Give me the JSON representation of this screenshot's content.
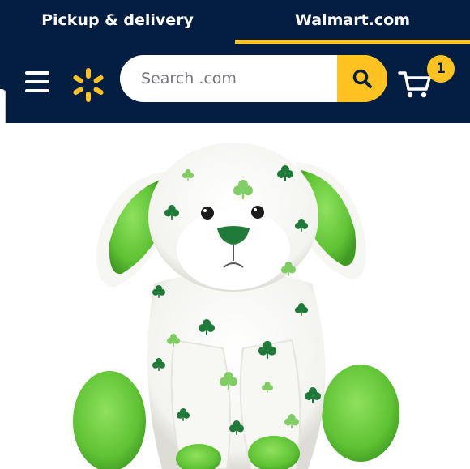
{
  "header": {
    "tabs": [
      {
        "label": "Pickup & delivery",
        "active": false
      },
      {
        "label": "Walmart.com",
        "active": true
      }
    ],
    "search": {
      "placeholder": "Search .com",
      "value": ""
    },
    "cart": {
      "count": "1"
    }
  },
  "colors": {
    "header_background": "#041e42",
    "accent_yellow": "#ffc220",
    "plush_green": "#63c43c",
    "clover_dark_green": "#1f7a3a"
  },
  "icons": {
    "menu": "hamburger-menu-icon",
    "logo": "walmart-spark-icon",
    "search": "magnifier-search-icon",
    "cart": "shopping-cart-icon"
  }
}
